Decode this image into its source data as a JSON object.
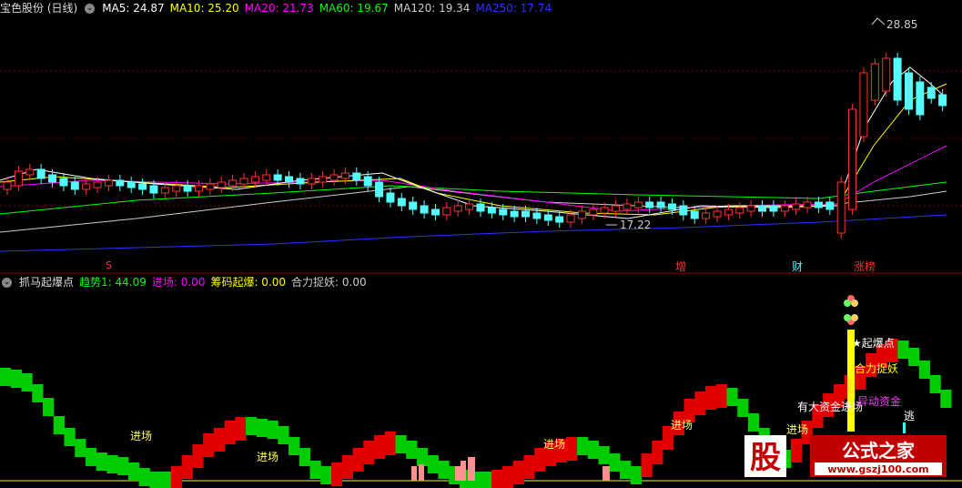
{
  "colors": {
    "up": "#ff3232",
    "down": "#54fcfc",
    "ma5": "#ffffff",
    "ma10": "#ffff00",
    "ma20": "#ff00ff",
    "ma60": "#00ff00",
    "ma120": "#cccccc",
    "ma250": "#3030ff",
    "bg": "#000000",
    "divider": "#7a0000"
  },
  "main_legend": {
    "title": "宝色股份 (日线)",
    "items": [
      {
        "label": "MA5: 24.87",
        "color": "#ffffff"
      },
      {
        "label": "MA10: 25.20",
        "color": "#ffff00"
      },
      {
        "label": "MA20: 21.73",
        "color": "#ff00ff"
      },
      {
        "label": "MA60: 19.67",
        "color": "#00ff00"
      },
      {
        "label": "MA120: 19.34",
        "color": "#cccccc"
      },
      {
        "label": "MA250: 17.74",
        "color": "#3030ff"
      }
    ]
  },
  "price_marks": {
    "high": "28.85",
    "low": "17.22"
  },
  "event_tags": [
    {
      "text": "S",
      "color": "#ff3030"
    },
    {
      "text": "增",
      "color": "#ff3030"
    },
    {
      "text": "财",
      "color": "#33ffff"
    },
    {
      "text": "涨榜",
      "color": "#ff3030"
    }
  ],
  "sub_legend": {
    "title": "抓马起爆点",
    "items": [
      {
        "label": "趋势1: 44.09",
        "color": "#00ff00"
      },
      {
        "label": "进场: 0.00",
        "color": "#ff00ff"
      },
      {
        "label": "筹码起爆: 0.00",
        "color": "#ffff00"
      },
      {
        "label": "合力捉妖: 0.00",
        "color": "#cccccc"
      }
    ]
  },
  "signal_labels": [
    {
      "text": "进场",
      "color": "#ffff66"
    },
    {
      "text": "进场",
      "color": "#ffff66"
    },
    {
      "text": "进场",
      "color": "#ffff66"
    },
    {
      "text": "进场",
      "color": "#ffff66"
    },
    {
      "text": "进场",
      "color": "#ffff66"
    },
    {
      "text": "有大资金进场",
      "color": "#ffffff"
    },
    {
      "text": "★起爆点",
      "color": "#ffffff"
    },
    {
      "text": "合力捉妖",
      "color": "#ffff00"
    },
    {
      "text": "异动资金",
      "color": "#ff33ff"
    },
    {
      "text": "逃",
      "color": "#ffffff"
    }
  ],
  "watermark": {
    "brand": "公式之家",
    "url": "www.gszj100.com",
    "logo_glyph": "股"
  }
}
